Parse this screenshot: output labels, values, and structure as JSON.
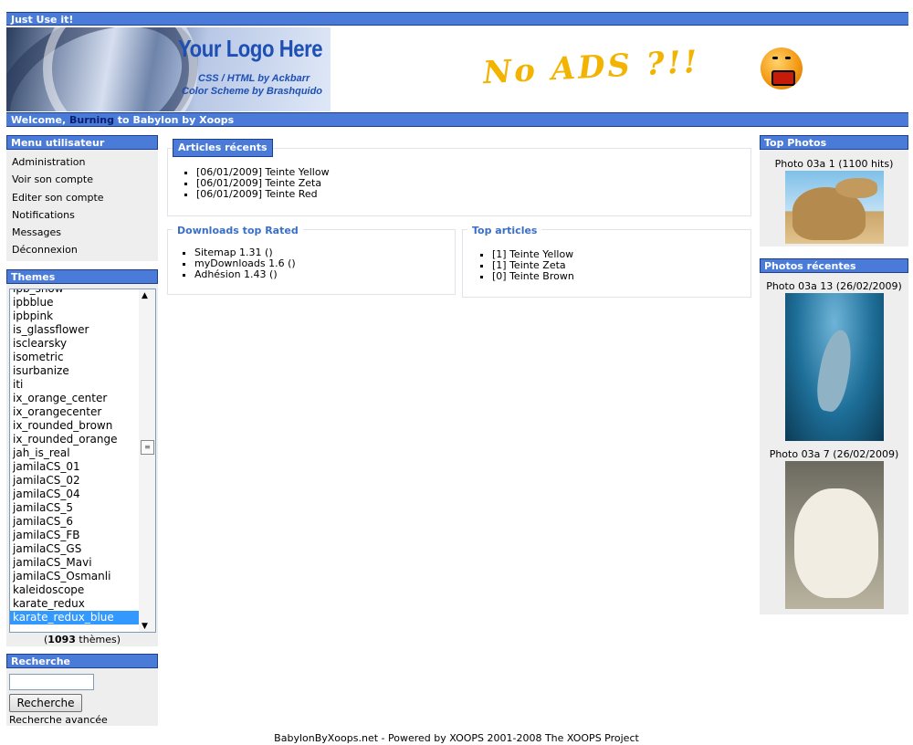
{
  "topbar": {
    "title": "Just Use it!"
  },
  "header": {
    "logo_title": "Your Logo Here",
    "logo_line1": "CSS / HTML by Ackbarr",
    "logo_line2": "Color Scheme by Brashquido",
    "banner": "No ADS ?!!"
  },
  "welcome": {
    "prefix": "Welcome,",
    "user": "Burning",
    "suffix": "to Babylon by Xoops"
  },
  "usermenu": {
    "title": "Menu utilisateur",
    "items": [
      "Administration",
      "Voir son compte",
      "Editer son compte",
      "Notifications",
      "Messages",
      "Déconnexion"
    ]
  },
  "themes": {
    "title": "Themes",
    "items": [
      "ipb_snow",
      "ipbblue",
      "ipbpink",
      "is_glassflower",
      "isclearsky",
      "isometric",
      "isurbanize",
      "iti",
      "ix_orange_center",
      "ix_orangecenter",
      "ix_rounded_brown",
      "ix_rounded_orange",
      "jah_is_real",
      "jamilaCS_01",
      "jamilaCS_02",
      "jamilaCS_04",
      "jamilaCS_5",
      "jamilaCS_6",
      "jamilaCS_FB",
      "jamilaCS_GS",
      "jamilaCS_Mavi",
      "jamilaCS_Osmanli",
      "kaleidoscope",
      "karate_redux",
      "karate_redux_blue"
    ],
    "selected": "karate_redux_blue",
    "count": "1093",
    "count_suffix": "thèmes"
  },
  "search": {
    "title": "Recherche",
    "button": "Recherche",
    "advanced": "Recherche avancée",
    "value": ""
  },
  "recent_articles": {
    "title": "Articles récents",
    "items": [
      "[06/01/2009] Teinte Yellow",
      "[06/01/2009] Teinte Zeta",
      "[06/01/2009] Teinte Red"
    ]
  },
  "downloads": {
    "title": "Downloads top Rated",
    "items": [
      "Sitemap 1.31 ()",
      "myDownloads 1.6 ()",
      "Adhésion 1.43 ()"
    ]
  },
  "top_articles": {
    "title": "Top articles",
    "items": [
      "[1] Teinte Yellow",
      "[1] Teinte Zeta",
      "[0] Teinte Brown"
    ]
  },
  "top_photos": {
    "title": "Top Photos",
    "caption": "Photo 03a 1 (1100 hits)"
  },
  "recent_photos": {
    "title": "Photos récentes",
    "captions": [
      "Photo 03a 13 (26/02/2009)",
      "Photo 03a 7 (26/02/2009)"
    ]
  },
  "footer": {
    "text": "BabylonByXoops.net - Powered by XOOPS 2001-2008 The XOOPS Project"
  }
}
